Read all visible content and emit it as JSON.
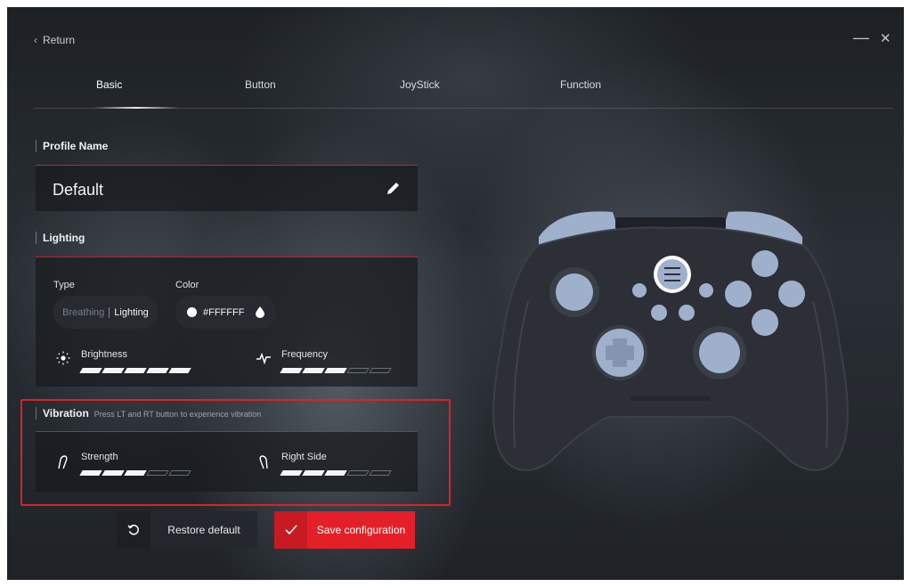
{
  "topbar": {
    "return_label": "Return",
    "minimize_glyph": "—",
    "close_glyph": "✕"
  },
  "tabs": [
    {
      "label": "Basic",
      "active": true
    },
    {
      "label": "Button",
      "active": false
    },
    {
      "label": "JoyStick",
      "active": false
    },
    {
      "label": "Function",
      "active": false
    }
  ],
  "profile": {
    "section_title": "Profile Name",
    "name": "Default",
    "edit_icon": "pencil-icon"
  },
  "lighting": {
    "section_title": "Lighting",
    "type_label": "Type",
    "type_options": [
      "Breathing",
      "Lighting"
    ],
    "type_selected": "Lighting",
    "color_label": "Color",
    "color_value": "#FFFFFF",
    "color_icon": "droplet-icon",
    "brightness": {
      "label": "Brightness",
      "icon": "sun-icon",
      "level": 5,
      "max": 5
    },
    "frequency": {
      "label": "Frequency",
      "icon": "pulse-icon",
      "level": 3,
      "max": 5
    }
  },
  "vibration": {
    "section_title": "Vibration",
    "hint": "Press LT and RT button to experience vibration",
    "strength": {
      "label": "Strength",
      "icon": "left-trigger-icon",
      "level": 3,
      "max": 5
    },
    "right_side": {
      "label": "Right Side",
      "icon": "right-trigger-icon",
      "level": 3,
      "max": 5
    }
  },
  "actions": {
    "restore_label": "Restore default",
    "save_label": "Save configuration"
  },
  "colors": {
    "accent_red": "#e32028",
    "controller_body": "#2c3036",
    "controller_buttons": "#9fb0cc"
  }
}
